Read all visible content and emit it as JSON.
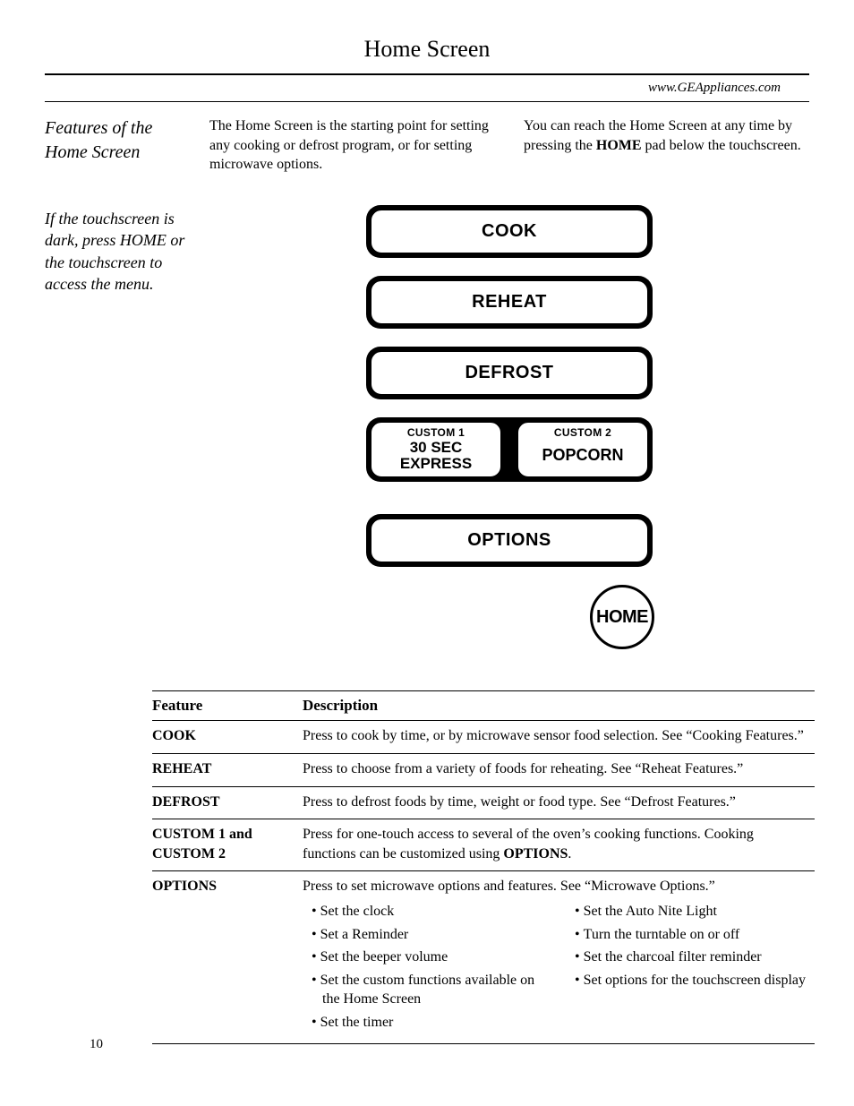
{
  "header": {
    "title": "Home Screen",
    "url": "www.GEAppliances.com"
  },
  "sidebar": {
    "title": "Features of the Home Screen",
    "note": "If the touchscreen is dark, press HOME or the touchscreen to access the menu."
  },
  "intro": {
    "left": "The Home Screen is the starting point for setting any cooking or defrost program, or for setting microwave options.",
    "right_a": "You can reach the Home Screen at any time by pressing the ",
    "right_bold": "HOME",
    "right_b": " pad below the touchscreen."
  },
  "ui": {
    "cook": "COOK",
    "reheat": "REHEAT",
    "defrost": "DEFROST",
    "custom1_label": "CUSTOM 1",
    "custom1_value_a": "30 SEC",
    "custom1_value_b": "EXPRESS",
    "custom2_label": "CUSTOM 2",
    "custom2_value": "POPCORN",
    "options": "OPTIONS",
    "home": "HOME"
  },
  "table": {
    "head_feature": "Feature",
    "head_desc": "Description",
    "rows": {
      "cook": {
        "name": "COOK",
        "desc": "Press to cook by time, or by microwave sensor food selection. See “Cooking Features.”"
      },
      "reheat": {
        "name": "REHEAT",
        "desc": "Press to choose from a variety of foods for reheating. See “Reheat Features.”"
      },
      "defrost": {
        "name": "DEFROST",
        "desc": "Press to defrost foods by time, weight or food type. See “Defrost Features.”"
      },
      "custom": {
        "name": "CUSTOM 1 and CUSTOM 2",
        "desc_a": "Press for one-touch access to several of the oven’s cooking functions. Cooking functions can be customized using ",
        "desc_bold": "OPTIONS",
        "desc_b": "."
      },
      "options": {
        "name": "OPTIONS",
        "desc": "Press to set microwave options and features. See “Microwave Options.”",
        "left": [
          "Set the clock",
          "Set a Reminder",
          "Set the beeper volume",
          "Set the custom functions available on the Home Screen",
          "Set the timer"
        ],
        "right": [
          "Set the Auto Nite Light",
          "Turn the turntable on or off",
          "Set the charcoal filter reminder",
          "Set options for the touchscreen display"
        ]
      }
    }
  },
  "page_number": "10"
}
